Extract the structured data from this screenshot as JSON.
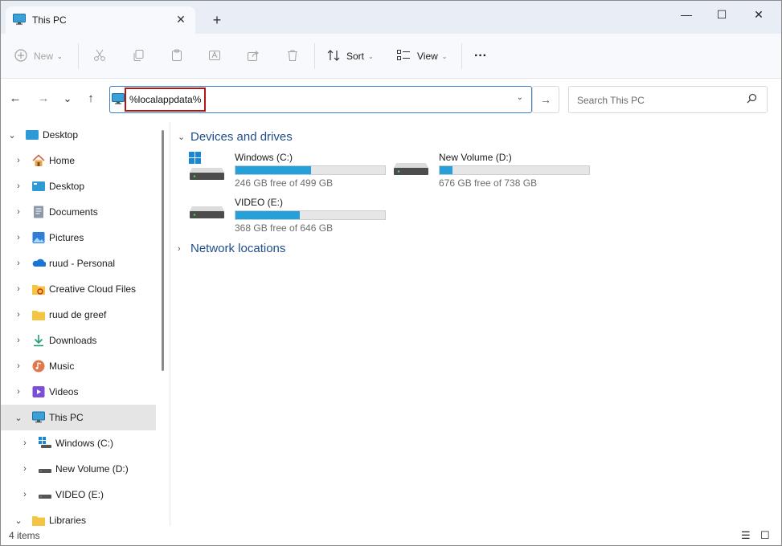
{
  "window": {
    "tab_title": "This PC",
    "tab_close": "✕",
    "new_tab": "+",
    "minimize": "—",
    "maximize": "☐",
    "close": "✕"
  },
  "toolbar": {
    "new_label": "New",
    "sort_label": "Sort",
    "view_label": "View",
    "more": "···"
  },
  "nav": {
    "back": "←",
    "forward": "→",
    "recent": "⌄",
    "up": "↑",
    "address_value": "%localappdata%",
    "go": "→",
    "search_placeholder": "Search This PC"
  },
  "sidebar": {
    "items": [
      {
        "label": "Desktop",
        "icon": "desktop-folder-icon",
        "caret": "expanded"
      },
      {
        "label": "Home",
        "icon": "home-icon",
        "caret": "collapsed"
      },
      {
        "label": "Desktop",
        "icon": "desktop-icon",
        "caret": "collapsed"
      },
      {
        "label": "Documents",
        "icon": "documents-icon",
        "caret": "collapsed"
      },
      {
        "label": "Pictures",
        "icon": "pictures-icon",
        "caret": "collapsed"
      },
      {
        "label": "ruud - Personal",
        "icon": "onedrive-icon",
        "caret": "collapsed"
      },
      {
        "label": "Creative Cloud Files",
        "icon": "creative-cloud-folder-icon",
        "caret": "collapsed"
      },
      {
        "label": "ruud de greef",
        "icon": "user-folder-icon",
        "caret": "collapsed"
      },
      {
        "label": "Downloads",
        "icon": "downloads-icon",
        "caret": "collapsed"
      },
      {
        "label": "Music",
        "icon": "music-icon",
        "caret": "collapsed"
      },
      {
        "label": "Videos",
        "icon": "videos-icon",
        "caret": "collapsed"
      },
      {
        "label": "This PC",
        "icon": "this-pc-icon",
        "caret": "expanded",
        "selected": true
      },
      {
        "label": "Windows (C:)",
        "icon": "windows-drive-icon",
        "caret": "collapsed"
      },
      {
        "label": "New Volume (D:)",
        "icon": "drive-icon",
        "caret": "collapsed"
      },
      {
        "label": "VIDEO (E:)",
        "icon": "drive-icon",
        "caret": "collapsed"
      },
      {
        "label": "Libraries",
        "icon": "libraries-icon",
        "caret": "expanded"
      }
    ]
  },
  "content": {
    "group_devices": "Devices and drives",
    "group_network": "Network locations",
    "drives": [
      {
        "name": "Windows (C:)",
        "free": "246 GB free of 499 GB",
        "used_fraction": 0.507,
        "icon": "windows-drive-icon"
      },
      {
        "name": "New Volume (D:)",
        "free": "676 GB free of 738 GB",
        "used_fraction": 0.084,
        "icon": "hard-drive-icon"
      },
      {
        "name": "VIDEO (E:)",
        "free": "368 GB free of 646 GB",
        "used_fraction": 0.43,
        "icon": "hard-drive-icon"
      }
    ]
  },
  "status": {
    "count": "4 items"
  },
  "colors": {
    "accent": "#26a0da",
    "address_highlight": "#b01818",
    "group_heading": "#1f4e8c"
  }
}
